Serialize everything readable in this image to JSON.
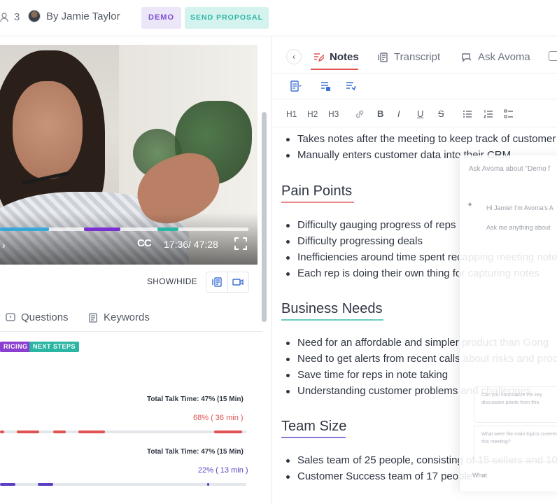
{
  "topbar": {
    "attendee_count": "3",
    "author": "By Jamie Taylor",
    "demo_badge": "DEMO",
    "send_proposal": "SEND PROPOSAL"
  },
  "video": {
    "timestamp": "17:36/ 47:28",
    "cc_label": "CC",
    "show_hide_label": "SHOW/HIDE"
  },
  "left_tabs": [
    {
      "label": "Questions"
    },
    {
      "label": "Keywords"
    }
  ],
  "tags": [
    {
      "label": "RICING",
      "color": "#8a3fd1"
    },
    {
      "label": "NEXT STEPS",
      "color": "#2bb5a3"
    }
  ],
  "talk_time": [
    {
      "label": "Total Talk Time: 47% (15 Min)",
      "value": "68%  ( 36 min )",
      "color": "#e05252"
    },
    {
      "label": "Total Talk Time: 47% (15 Min)",
      "value": "22%  ( 13 min )",
      "color": "#5b3fc4"
    }
  ],
  "right_tabs": [
    {
      "label": "Notes",
      "active": true
    },
    {
      "label": "Transcript",
      "active": false
    },
    {
      "label": "Ask Avoma",
      "active": false
    }
  ],
  "format_toolbar": [
    "H1",
    "H2",
    "H3"
  ],
  "notes": {
    "intro_bullets": [
      "Takes notes after the meeting to keep track of customer",
      "Manually enters customer data into their CRM"
    ],
    "sections": [
      {
        "heading": "Pain Points",
        "underline": "#e05252",
        "bullets": [
          "Difficulty gauging progress of reps",
          "Difficulty progressing deals",
          "Inefficiencies around time spent recapping meeting note",
          "Each rep is doing their own thing for capturing notes"
        ]
      },
      {
        "heading": "Business Needs",
        "underline": "#2bb5a3",
        "bullets": [
          "Need for an affordable and simpler product than Gong",
          "Need to get alerts from recent calls about risks and proc",
          "Save time for reps in note taking",
          "Understanding customer problems and challenges"
        ]
      },
      {
        "heading": "Team Size",
        "underline": "#5b3fc4",
        "bullets": [
          "Sales team of 25 people, consisting of 15 sellers and 10",
          "Customer Success team of 17 people"
        ]
      }
    ]
  },
  "ask_avoma": {
    "header": "Ask Avoma about \"Demo f",
    "greeting": "Hi Jamie! I'm Avoma's A",
    "prompt": "Ask me anything about",
    "suggestion_1": "Can you summarize the key discussion points from this",
    "suggestion_2": "What were the main topics covered in this meeting?",
    "input_placeholder": "What"
  },
  "colors": {
    "accent_red": "#e05252",
    "accent_teal": "#2bb5a3",
    "accent_purple": "#5b3fc4",
    "toolbar_blue": "#3b6fd4"
  }
}
